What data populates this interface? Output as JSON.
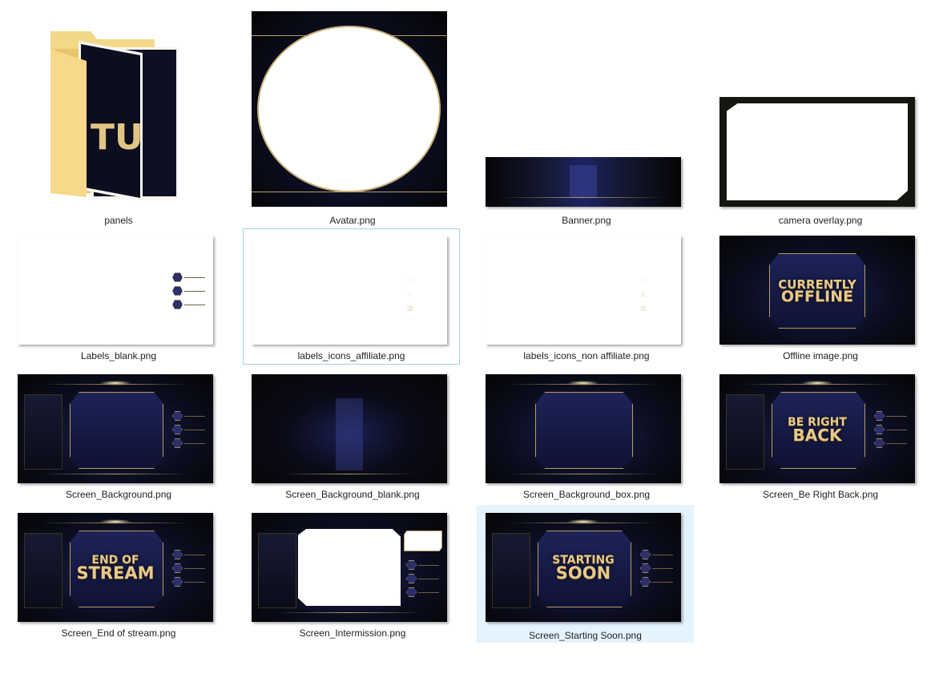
{
  "files": [
    {
      "name": "panels",
      "kind": "folder",
      "thumb_text": "TU"
    },
    {
      "name": "Avatar.png",
      "kind": "image"
    },
    {
      "name": "Banner.png",
      "kind": "image"
    },
    {
      "name": "camera overlay.png",
      "kind": "image"
    },
    {
      "name": "Labels_blank.png",
      "kind": "image"
    },
    {
      "name": "labels_icons_affiliate.png",
      "kind": "image",
      "state": "focused"
    },
    {
      "name": "labels_icons_non affiliate.png",
      "kind": "image"
    },
    {
      "name": "Offline image.png",
      "kind": "image",
      "overlay_text": [
        "CURRENTLY",
        "OFFLINE"
      ]
    },
    {
      "name": "Screen_Background.png",
      "kind": "image"
    },
    {
      "name": "Screen_Background_blank.png",
      "kind": "image"
    },
    {
      "name": "Screen_Background_box.png",
      "kind": "image"
    },
    {
      "name": "Screen_Be Right Back.png",
      "kind": "image",
      "overlay_text": [
        "BE RIGHT",
        "BACK"
      ]
    },
    {
      "name": "Screen_End of stream.png",
      "kind": "image",
      "overlay_text": [
        "END OF",
        "STREAM"
      ]
    },
    {
      "name": "Screen_Intermission.png",
      "kind": "image"
    },
    {
      "name": "Screen_Starting Soon.png",
      "kind": "image",
      "state": "selected",
      "overlay_text": [
        "STARTING",
        "SOON"
      ]
    }
  ],
  "colors": {
    "selection_bg": "#e5f3ff",
    "focus_border": "#9fd3ef",
    "gold": "#e7c98a",
    "navy": "#1c2150"
  }
}
